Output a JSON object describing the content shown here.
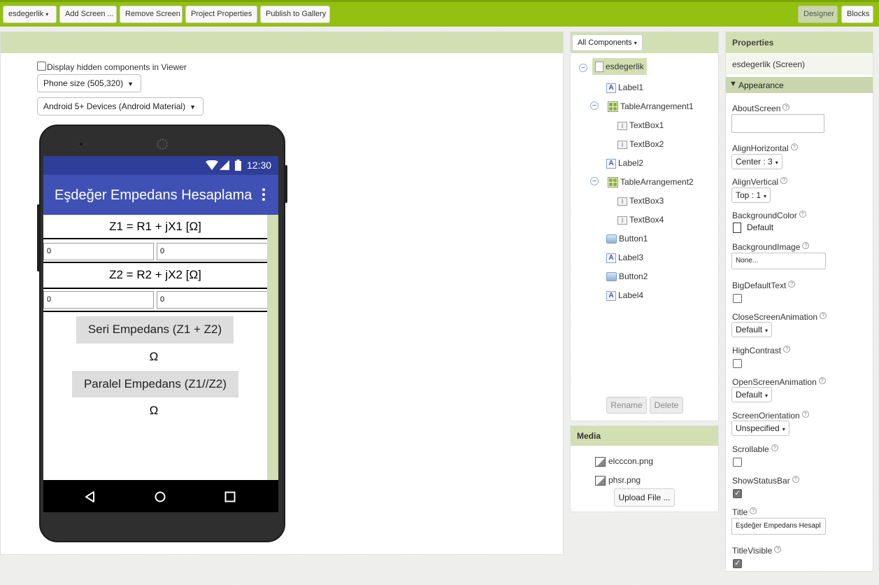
{
  "toolbar": {
    "project_menu": "esdegerlik",
    "add_screen": "Add Screen ...",
    "remove_screen": "Remove Screen",
    "project_properties": "Project Properties",
    "publish": "Publish to Gallery",
    "designer": "Designer",
    "blocks": "Blocks"
  },
  "viewer": {
    "display_hidden": "Display hidden components in Viewer",
    "phone_size": "Phone size (505,320)",
    "device_theme": "Android 5+ Devices (Android Material)"
  },
  "phone": {
    "time": "12:30",
    "app_title": "Eşdeğer Empedans Hesaplama",
    "label1": "Z1 = R1 + jX1 [Ω]",
    "textbox1": "0",
    "textbox2": "0",
    "label2": "Z2 = R2 + jX2 [Ω]",
    "textbox3": "0",
    "textbox4": "0",
    "button1": "Seri Empedans (Z1 + Z2)",
    "label3": "Ω",
    "button2": "Paralel Empedans (Z1//Z2)",
    "label4": "Ω"
  },
  "components": {
    "dropdown": "All Components",
    "tree": [
      "esdegerlik",
      "Label1",
      "TableArrangement1",
      "TextBox1",
      "TextBox2",
      "Label2",
      "TableArrangement2",
      "TextBox3",
      "TextBox4",
      "Button1",
      "Label3",
      "Button2",
      "Label4"
    ],
    "rename": "Rename",
    "delete": "Delete"
  },
  "media": {
    "title": "Media",
    "files": [
      "elcccon.png",
      "phsr.png"
    ],
    "upload": "Upload File ..."
  },
  "properties": {
    "title": "Properties",
    "screen_name": "esdegerlik (Screen)",
    "section": "Appearance",
    "about_screen": "AboutScreen",
    "align_horizontal": "AlignHorizontal",
    "align_horizontal_value": "Center : 3",
    "align_vertical": "AlignVertical",
    "align_vertical_value": "Top : 1",
    "background_color": "BackgroundColor",
    "background_color_value": "Default",
    "background_image": "BackgroundImage",
    "background_image_value": "None...",
    "big_default_text": "BigDefaultText",
    "close_screen_animation": "CloseScreenAnimation",
    "close_screen_animation_value": "Default",
    "high_contrast": "HighContrast",
    "open_screen_animation": "OpenScreenAnimation",
    "open_screen_animation_value": "Default",
    "screen_orientation": "ScreenOrientation",
    "screen_orientation_value": "Unspecified",
    "scrollable": "Scrollable",
    "show_status_bar": "ShowStatusBar",
    "title_label": "Title",
    "title_value": "Eşdeğer Empedans Hesapl",
    "title_visible": "TitleVisible"
  },
  "colors": {
    "toolbar_green": "#93c011",
    "panel_header": "#d2dfb2",
    "app_bar": "#3f51b5",
    "status_bar": "#2f3e99"
  }
}
